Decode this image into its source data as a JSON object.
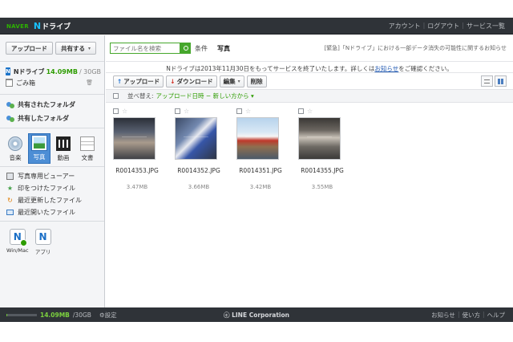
{
  "header": {
    "naver": "NAVER",
    "ndrive_n": "N",
    "ndrive_text": "ドライブ",
    "links": [
      "アカウント",
      "ログアウト",
      "サービス一覧"
    ]
  },
  "sidebar": {
    "upload_button": "アップロード",
    "share_button": "共有する",
    "drive_label": "Nドライブ",
    "drive_used": "14.09MB",
    "drive_total": "/ 30GB",
    "trash_label": "ごみ箱",
    "shared_items": [
      "共有されたフォルダ",
      "共有したフォルダ"
    ],
    "types": [
      "音楽",
      "写真",
      "動画",
      "文書"
    ],
    "active_type": "写真",
    "menu_items": [
      "写真専用ビューアー",
      "印をつけたファイル",
      "最近更新したファイル",
      "最近開いたファイル"
    ],
    "apps": [
      "Win/Mac",
      "アプリ"
    ]
  },
  "main": {
    "search_placeholder": "ファイル名を検索",
    "condition_label": "条件",
    "breadcrumb": "写真",
    "urgent_notice": "[緊急]「Nドライブ」における一部データ消失の可能性に関するお知らせ",
    "notice_text": "Nドライブは2013年11月30日をもってサービスを終了いたします。詳しくは",
    "notice_link": "お知らせ",
    "notice_tail": "をご確認ください。",
    "toolbar": {
      "upload": "アップロード",
      "download": "ダウンロード",
      "edit": "編集",
      "delete": "削除"
    },
    "sort_label": "並べ替え:",
    "sort_value": "アップロード日時 − 新しい方から ▾",
    "files": [
      {
        "name": "R0014353.JPG",
        "size": "3.47MB"
      },
      {
        "name": "R0014352.JPG",
        "size": "3.66MB"
      },
      {
        "name": "R0014351.JPG",
        "size": "3.42MB"
      },
      {
        "name": "R0014355.JPG",
        "size": "3.55MB"
      }
    ]
  },
  "footer": {
    "used": "14.09MB",
    "total": "/30GB",
    "settings": "設定",
    "copyright": "ⓒ LINE Corporation",
    "links": [
      "お知らせ",
      "使い方",
      "ヘルプ"
    ],
    "quota_fraction": 0.0005
  },
  "colors": {
    "accent_green": "#2d9c00",
    "active_blue": "#4d8ed5",
    "bar_dark": "#2f3338"
  }
}
